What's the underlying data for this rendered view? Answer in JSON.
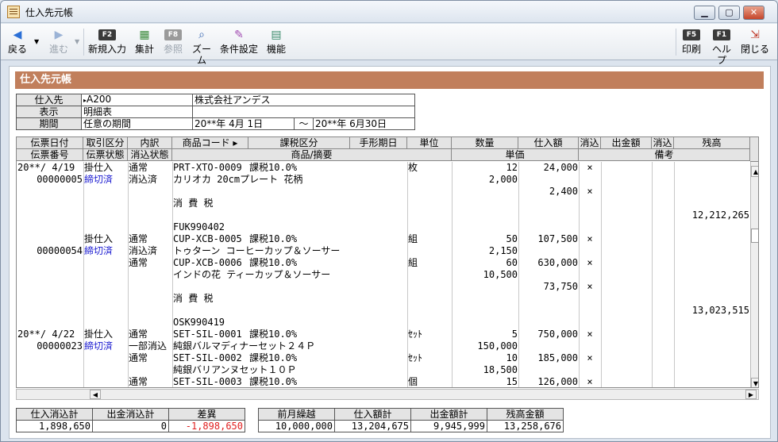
{
  "window": {
    "title": "仕入先元帳"
  },
  "toolbar": {
    "back": "戻る",
    "forward": "進む",
    "new_entry": "新規入力",
    "new_entry_key": "F2",
    "total": "集計",
    "ref": "参照",
    "ref_key": "F8",
    "zoom": "ズーム",
    "condition": "条件設定",
    "function": "機能",
    "print": "印刷",
    "print_key": "F5",
    "help": "ヘルプ",
    "help_key": "F1",
    "close": "閉じる"
  },
  "panel": {
    "title": "仕入先元帳"
  },
  "info": {
    "supplier_label": "仕入先",
    "supplier_code": "A200",
    "supplier_name": "株式会社アンデス",
    "display_label": "表示",
    "display_value": "明細表",
    "period_label": "期間",
    "period_value": "任意の期間",
    "period_from": "20**年 4月 1日",
    "period_sep": "～",
    "period_to": "20**年 6月30日"
  },
  "grid": {
    "header1": [
      "伝票日付",
      "取引区分",
      "内訳",
      "商品コード ▸",
      "課税区分",
      "手形期日",
      "単位",
      "数量",
      "仕入額",
      "消込",
      "出金額",
      "消込",
      "残高"
    ],
    "header2": [
      "伝票番号",
      "伝票状態",
      "消込状態",
      "商品/摘要",
      "単価",
      "備考"
    ],
    "rows": [
      {
        "date": "20**/ 4/19",
        "type": "掛仕入",
        "breakdown": "通常",
        "code": "PRT-XTO-0009",
        "tax": "課税10.0%",
        "due": "",
        "unit": "枚",
        "qty": "12",
        "purchase": "24,000",
        "clear": "×",
        "payment": "",
        "clear2": "",
        "balance": ""
      },
      {
        "date": "00000005",
        "type": "締切済",
        "breakdown": "消込済",
        "code": "カリオカ 20cmプレート 花柄",
        "tax": "",
        "due": "",
        "unit": "",
        "qty": "2,000",
        "purchase": "",
        "clear": "",
        "payment": "",
        "clear2": "",
        "balance": ""
      },
      {
        "date": "",
        "type": "",
        "breakdown": "",
        "code": "",
        "tax": "",
        "due": "",
        "unit": "",
        "qty": "",
        "purchase": "2,400",
        "clear": "×",
        "payment": "",
        "clear2": "",
        "balance": ""
      },
      {
        "date": "",
        "type": "",
        "breakdown": "",
        "code": "消 費 税",
        "tax": "",
        "due": "",
        "unit": "",
        "qty": "",
        "purchase": "",
        "clear": "",
        "payment": "",
        "clear2": "",
        "balance": ""
      },
      {
        "date": "",
        "type": "",
        "breakdown": "",
        "code": "",
        "tax": "",
        "due": "",
        "unit": "",
        "qty": "",
        "purchase": "",
        "clear": "",
        "payment": "",
        "clear2": "",
        "balance": "12,212,265"
      },
      {
        "date": "",
        "type": "",
        "breakdown": "",
        "code": "FUK990402",
        "tax": "",
        "due": "",
        "unit": "",
        "qty": "",
        "purchase": "",
        "clear": "",
        "payment": "",
        "clear2": "",
        "balance": ""
      },
      {
        "date": "",
        "type": "掛仕入",
        "breakdown": "通常",
        "code": "CUP-XCB-0005",
        "tax": "課税10.0%",
        "due": "",
        "unit": "組",
        "qty": "50",
        "purchase": "107,500",
        "clear": "×",
        "payment": "",
        "clear2": "",
        "balance": ""
      },
      {
        "date": "00000054",
        "type": "締切済",
        "breakdown": "消込済",
        "code": "トゥターン コーヒーカップ＆ソーサー",
        "tax": "",
        "due": "",
        "unit": "",
        "qty": "2,150",
        "purchase": "",
        "clear": "",
        "payment": "",
        "clear2": "",
        "balance": ""
      },
      {
        "date": "",
        "type": "",
        "breakdown": "通常",
        "code": "CUP-XCB-0006",
        "tax": "課税10.0%",
        "due": "",
        "unit": "組",
        "qty": "60",
        "purchase": "630,000",
        "clear": "×",
        "payment": "",
        "clear2": "",
        "balance": ""
      },
      {
        "date": "",
        "type": "",
        "breakdown": "",
        "code": "インドの花 ティーカップ＆ソーサー",
        "tax": "",
        "due": "",
        "unit": "",
        "qty": "10,500",
        "purchase": "",
        "clear": "",
        "payment": "",
        "clear2": "",
        "balance": ""
      },
      {
        "date": "",
        "type": "",
        "breakdown": "",
        "code": "",
        "tax": "",
        "due": "",
        "unit": "",
        "qty": "",
        "purchase": "73,750",
        "clear": "×",
        "payment": "",
        "clear2": "",
        "balance": ""
      },
      {
        "date": "",
        "type": "",
        "breakdown": "",
        "code": "消 費 税",
        "tax": "",
        "due": "",
        "unit": "",
        "qty": "",
        "purchase": "",
        "clear": "",
        "payment": "",
        "clear2": "",
        "balance": ""
      },
      {
        "date": "",
        "type": "",
        "breakdown": "",
        "code": "",
        "tax": "",
        "due": "",
        "unit": "",
        "qty": "",
        "purchase": "",
        "clear": "",
        "payment": "",
        "clear2": "",
        "balance": "13,023,515"
      },
      {
        "date": "",
        "type": "",
        "breakdown": "",
        "code": "OSK990419",
        "tax": "",
        "due": "",
        "unit": "",
        "qty": "",
        "purchase": "",
        "clear": "",
        "payment": "",
        "clear2": "",
        "balance": ""
      },
      {
        "date": "20**/ 4/22",
        "type": "掛仕入",
        "breakdown": "通常",
        "code": "SET-SIL-0001",
        "tax": "課税10.0%",
        "due": "",
        "unit": "ｾｯﾄ",
        "qty": "5",
        "purchase": "750,000",
        "clear": "×",
        "payment": "",
        "clear2": "",
        "balance": ""
      },
      {
        "date": "00000023",
        "type": "締切済",
        "breakdown": "一部消込",
        "code": "純銀バルマディナーセット２４Ｐ",
        "tax": "",
        "due": "",
        "unit": "",
        "qty": "150,000",
        "purchase": "",
        "clear": "",
        "payment": "",
        "clear2": "",
        "balance": ""
      },
      {
        "date": "",
        "type": "",
        "breakdown": "通常",
        "code": "SET-SIL-0002",
        "tax": "課税10.0%",
        "due": "",
        "unit": "ｾｯﾄ",
        "qty": "10",
        "purchase": "185,000",
        "clear": "×",
        "payment": "",
        "clear2": "",
        "balance": ""
      },
      {
        "date": "",
        "type": "",
        "breakdown": "",
        "code": "純銀バリアンヌセット１０Ｐ",
        "tax": "",
        "due": "",
        "unit": "",
        "qty": "18,500",
        "purchase": "",
        "clear": "",
        "payment": "",
        "clear2": "",
        "balance": ""
      },
      {
        "date": "",
        "type": "",
        "breakdown": "通常",
        "code": "SET-SIL-0003",
        "tax": "課税10.0%",
        "due": "",
        "unit": "個",
        "qty": "15",
        "purchase": "126,000",
        "clear": "×",
        "payment": "",
        "clear2": "",
        "balance": ""
      }
    ]
  },
  "totals": {
    "purchase_clear_label": "仕入消込計",
    "purchase_clear_value": "1,898,650",
    "payment_clear_label": "出金消込計",
    "payment_clear_value": "0",
    "diff_label": "差異",
    "diff_value": "-1,898,650",
    "prev_label": "前月繰越",
    "prev_value": "10,000,000",
    "purchase_total_label": "仕入額計",
    "purchase_total_value": "13,204,675",
    "payment_total_label": "出金額計",
    "payment_total_value": "9,945,999",
    "balance_label": "残高金額",
    "balance_value": "13,258,676"
  },
  "colors": {
    "panel_header": "#c17f5c",
    "negative": "#e02020",
    "status_blue": "#1a1ad0"
  }
}
